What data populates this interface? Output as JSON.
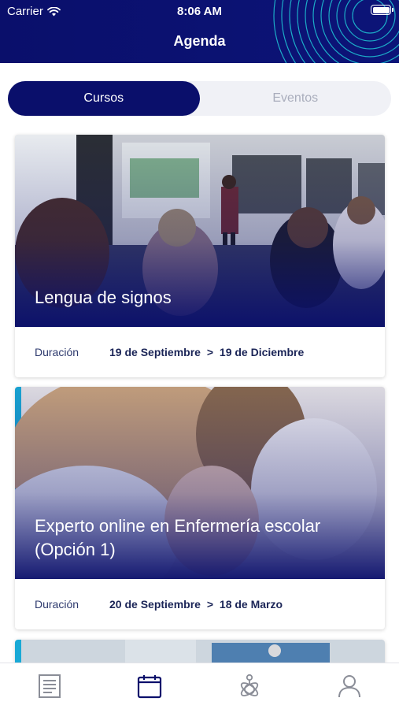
{
  "status_bar": {
    "carrier": "Carrier",
    "time": "8:06 AM",
    "icons": [
      "wifi-icon",
      "battery-icon"
    ]
  },
  "header": {
    "title": "Agenda"
  },
  "segments": {
    "items": [
      {
        "label": "Cursos",
        "selected": true
      },
      {
        "label": "Eventos",
        "selected": false
      }
    ]
  },
  "courses": [
    {
      "title": "Lengua de signos",
      "duration_label": "Duración",
      "start": "19 de Septiembre",
      "separator": ">",
      "end": "19 de Diciembre"
    },
    {
      "title": "Experto online en Enfermería escolar (Opción 1)",
      "duration_label": "Duración",
      "start": "20 de Septiembre",
      "separator": ">",
      "end": "18 de Marzo"
    }
  ],
  "tabbar": {
    "items": [
      {
        "icon": "document-icon",
        "selected": false
      },
      {
        "icon": "calendar-icon",
        "selected": true
      },
      {
        "icon": "molecule-icon",
        "selected": false
      },
      {
        "icon": "profile-icon",
        "selected": false
      }
    ]
  },
  "colors": {
    "brand_navy": "#0a0f6b",
    "accent_cyan": "#19c3d9",
    "inactive_text": "#a9adbc",
    "tab_inactive": "#8a8d97"
  }
}
